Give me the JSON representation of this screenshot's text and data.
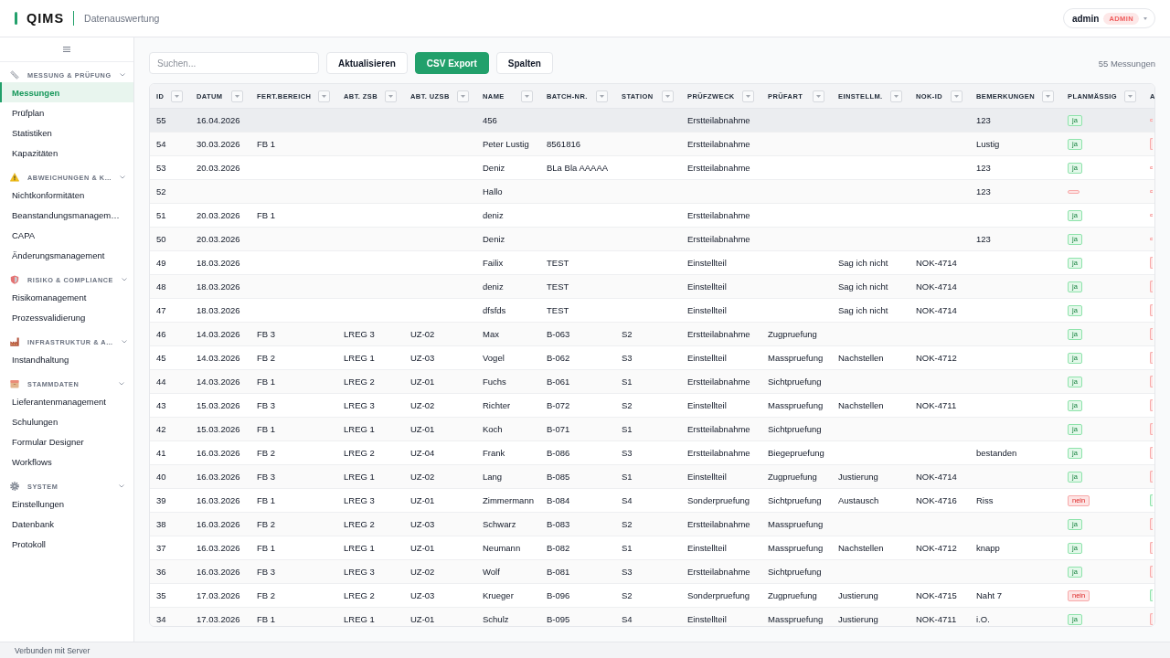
{
  "header": {
    "logo": "QIMS",
    "title": "Datenauswertung",
    "user": {
      "name": "admin",
      "role": "ADMIN"
    }
  },
  "sidebar": {
    "groups": [
      {
        "title": "MESSUNG & PRÜFUNG",
        "expanded": true,
        "items": [
          {
            "label": "Messungen",
            "selected": true
          },
          {
            "label": "Prüfplan",
            "selected": false
          },
          {
            "label": "Statistiken",
            "selected": false
          },
          {
            "label": "Kapazitäten",
            "selected": false
          }
        ]
      },
      {
        "title": "ABWEICHUNGEN & K…",
        "expanded": true,
        "items": [
          {
            "label": "Nichtkonformitäten",
            "selected": false
          },
          {
            "label": "Beanstandungsmanagem…",
            "selected": false
          },
          {
            "label": "CAPA",
            "selected": false
          },
          {
            "label": "Änderungsmanagement",
            "selected": false
          }
        ]
      },
      {
        "title": "RISIKO & COMPLIANCE",
        "expanded": true,
        "items": [
          {
            "label": "Risikomanagement",
            "selected": false
          },
          {
            "label": "Prozessvalidierung",
            "selected": false
          }
        ]
      },
      {
        "title": "INFRASTRUKTUR & A…",
        "expanded": true,
        "items": [
          {
            "label": "Instandhaltung",
            "selected": false
          }
        ]
      },
      {
        "title": "STAMMDATEN",
        "expanded": true,
        "items": [
          {
            "label": "Lieferantenmanagement",
            "selected": false
          },
          {
            "label": "Schulungen",
            "selected": false
          },
          {
            "label": "Formular Designer",
            "selected": false
          },
          {
            "label": "Workflows",
            "selected": false
          }
        ]
      },
      {
        "title": "SYSTEM",
        "expanded": true,
        "items": [
          {
            "label": "Einstellungen",
            "selected": false
          },
          {
            "label": "Datenbank",
            "selected": false
          },
          {
            "label": "Protokoll",
            "selected": false
          }
        ]
      }
    ]
  },
  "toolbar": {
    "search": {
      "placeholder": "Suchen..."
    },
    "buttons": [
      {
        "label": "Aktualisieren",
        "kind": "default"
      },
      {
        "label": "CSV Export",
        "kind": "primary"
      },
      {
        "label": "Spalten",
        "kind": "default"
      }
    ],
    "count": "55 Messungen"
  },
  "table": {
    "columns": [
      {
        "label": "ID"
      },
      {
        "label": "DATUM"
      },
      {
        "label": "FERT.BEREICH"
      },
      {
        "label": "ABT. ZSB"
      },
      {
        "label": "ABT. UZSB"
      },
      {
        "label": "NAME"
      },
      {
        "label": "BATCH-NR."
      },
      {
        "label": "STATION"
      },
      {
        "label": "PRÜFZWECK"
      },
      {
        "label": "PRÜFART"
      },
      {
        "label": "EINSTELLM."
      },
      {
        "label": "NOK-ID"
      },
      {
        "label": "BEMERKUNGEN"
      },
      {
        "label": "PLANMÄSSIG"
      },
      {
        "label": "A"
      }
    ],
    "rows": [
      {
        "selected": true,
        "id": "55",
        "datum": "16.04.2026",
        "name": "456",
        "pruefzweck": "Erstteilabnahme",
        "bemerkungen": "123",
        "planmaessig": {
          "text": "ja",
          "kind": "positive",
          "empty": false
        },
        "column_15": {
          "kind": "negative",
          "empty": true
        }
      },
      {
        "selected": false,
        "id": "54",
        "datum": "30.03.2026",
        "fert_bereich": "FB 1",
        "name": "Peter Lustig",
        "batch_nr": "8561816",
        "pruefzweck": "Erstteilabnahme",
        "bemerkungen": "Lustig",
        "planmaessig": {
          "text": "ja",
          "kind": "positive",
          "empty": false
        },
        "column_15": {
          "kind": "negative",
          "empty": false
        }
      },
      {
        "selected": false,
        "id": "53",
        "datum": "20.03.2026",
        "name": "Deniz",
        "batch_nr": "BLa Bla AAAAA",
        "pruefzweck": "Erstteilabnahme",
        "bemerkungen": "123",
        "planmaessig": {
          "text": "ja",
          "kind": "positive",
          "empty": false
        },
        "column_15": {
          "kind": "negative",
          "empty": true
        }
      },
      {
        "selected": false,
        "id": "52",
        "name": "Hallo",
        "bemerkungen": "123",
        "planmaessig": {
          "kind": "negative",
          "empty": true
        },
        "column_15": {
          "kind": "negative",
          "empty": true
        }
      },
      {
        "selected": false,
        "id": "51",
        "datum": "20.03.2026",
        "fert_bereich": "FB 1",
        "name": "deniz",
        "pruefzweck": "Erstteilabnahme",
        "planmaessig": {
          "text": "ja",
          "kind": "positive",
          "empty": false
        },
        "column_15": {
          "kind": "negative",
          "empty": true
        }
      },
      {
        "selected": false,
        "id": "50",
        "datum": "20.03.2026",
        "name": "Deniz",
        "pruefzweck": "Erstteilabnahme",
        "bemerkungen": "123",
        "planmaessig": {
          "text": "ja",
          "kind": "positive",
          "empty": false
        },
        "column_15": {
          "kind": "negative",
          "empty": true
        }
      },
      {
        "selected": false,
        "id": "49",
        "datum": "18.03.2026",
        "name": "Failix",
        "batch_nr": "TEST",
        "pruefzweck": "Einstellteil",
        "einstellm": "Sag ich nicht",
        "nok_id": "NOK-4714",
        "planmaessig": {
          "text": "ja",
          "kind": "positive",
          "empty": false
        },
        "column_15": {
          "kind": "negative",
          "empty": false
        }
      },
      {
        "selected": false,
        "id": "48",
        "datum": "18.03.2026",
        "name": "deniz",
        "batch_nr": "TEST",
        "pruefzweck": "Einstellteil",
        "einstellm": "Sag ich nicht",
        "nok_id": "NOK-4714",
        "planmaessig": {
          "text": "ja",
          "kind": "positive",
          "empty": false
        },
        "column_15": {
          "kind": "negative",
          "empty": false
        }
      },
      {
        "selected": false,
        "id": "47",
        "datum": "18.03.2026",
        "name": "dfsfds",
        "batch_nr": "TEST",
        "pruefzweck": "Einstellteil",
        "einstellm": "Sag ich nicht",
        "nok_id": "NOK-4714",
        "planmaessig": {
          "text": "ja",
          "kind": "positive",
          "empty": false
        },
        "column_15": {
          "kind": "negative",
          "empty": false
        }
      },
      {
        "selected": false,
        "id": "46",
        "datum": "14.03.2026",
        "fert_bereich": "FB 3",
        "abt_zsb": "LREG 3",
        "abt_uzsb": "UZ-02",
        "name": "Max",
        "batch_nr": "B-063",
        "station": "S2",
        "pruefzweck": "Erstteilabnahme",
        "pruefart": "Zugpruefung",
        "planmaessig": {
          "text": "ja",
          "kind": "positive",
          "empty": false
        },
        "column_15": {
          "kind": "negative",
          "empty": false
        }
      },
      {
        "selected": false,
        "id": "45",
        "datum": "14.03.2026",
        "fert_bereich": "FB 2",
        "abt_zsb": "LREG 1",
        "abt_uzsb": "UZ-03",
        "name": "Vogel",
        "batch_nr": "B-062",
        "station": "S3",
        "pruefzweck": "Einstellteil",
        "pruefart": "Masspruefung",
        "einstellm": "Nachstellen",
        "nok_id": "NOK-4712",
        "planmaessig": {
          "text": "ja",
          "kind": "positive",
          "empty": false
        },
        "column_15": {
          "kind": "negative",
          "empty": false
        }
      },
      {
        "selected": false,
        "id": "44",
        "datum": "14.03.2026",
        "fert_bereich": "FB 1",
        "abt_zsb": "LREG 2",
        "abt_uzsb": "UZ-01",
        "name": "Fuchs",
        "batch_nr": "B-061",
        "station": "S1",
        "pruefzweck": "Erstteilabnahme",
        "pruefart": "Sichtpruefung",
        "planmaessig": {
          "text": "ja",
          "kind": "positive",
          "empty": false
        },
        "column_15": {
          "kind": "negative",
          "empty": false
        }
      },
      {
        "selected": false,
        "id": "43",
        "datum": "15.03.2026",
        "fert_bereich": "FB 3",
        "abt_zsb": "LREG 3",
        "abt_uzsb": "UZ-02",
        "name": "Richter",
        "batch_nr": "B-072",
        "station": "S2",
        "pruefzweck": "Einstellteil",
        "pruefart": "Masspruefung",
        "einstellm": "Nachstellen",
        "nok_id": "NOK-4711",
        "planmaessig": {
          "text": "ja",
          "kind": "positive",
          "empty": false
        },
        "column_15": {
          "kind": "negative",
          "empty": false
        }
      },
      {
        "selected": false,
        "id": "42",
        "datum": "15.03.2026",
        "fert_bereich": "FB 1",
        "abt_zsb": "LREG 1",
        "abt_uzsb": "UZ-01",
        "name": "Koch",
        "batch_nr": "B-071",
        "station": "S1",
        "pruefzweck": "Erstteilabnahme",
        "pruefart": "Sichtpruefung",
        "planmaessig": {
          "text": "ja",
          "kind": "positive",
          "empty": false
        },
        "column_15": {
          "kind": "negative",
          "empty": false
        }
      },
      {
        "selected": false,
        "id": "41",
        "datum": "16.03.2026",
        "fert_bereich": "FB 2",
        "abt_zsb": "LREG 2",
        "abt_uzsb": "UZ-04",
        "name": "Frank",
        "batch_nr": "B-086",
        "station": "S3",
        "pruefzweck": "Erstteilabnahme",
        "pruefart": "Biegepruefung",
        "bemerkungen": "bestanden",
        "planmaessig": {
          "text": "ja",
          "kind": "positive",
          "empty": false
        },
        "column_15": {
          "kind": "negative",
          "empty": false
        }
      },
      {
        "selected": false,
        "id": "40",
        "datum": "16.03.2026",
        "fert_bereich": "FB 3",
        "abt_zsb": "LREG 1",
        "abt_uzsb": "UZ-02",
        "name": "Lang",
        "batch_nr": "B-085",
        "station": "S1",
        "pruefzweck": "Einstellteil",
        "pruefart": "Zugpruefung",
        "einstellm": "Justierung",
        "nok_id": "NOK-4714",
        "planmaessig": {
          "text": "ja",
          "kind": "positive",
          "empty": false
        },
        "column_15": {
          "kind": "negative",
          "empty": false
        }
      },
      {
        "selected": false,
        "id": "39",
        "datum": "16.03.2026",
        "fert_bereich": "FB 1",
        "abt_zsb": "LREG 3",
        "abt_uzsb": "UZ-01",
        "name": "Zimmermann",
        "batch_nr": "B-084",
        "station": "S4",
        "pruefzweck": "Sonderpruefung",
        "pruefart": "Sichtpruefung",
        "einstellm": "Austausch",
        "nok_id": "NOK-4716",
        "bemerkungen": "Riss",
        "planmaessig": {
          "text": "nein",
          "kind": "negative",
          "empty": false
        },
        "column_15": {
          "kind": "positive",
          "empty": false
        }
      },
      {
        "selected": false,
        "id": "38",
        "datum": "16.03.2026",
        "fert_bereich": "FB 2",
        "abt_zsb": "LREG 2",
        "abt_uzsb": "UZ-03",
        "name": "Schwarz",
        "batch_nr": "B-083",
        "station": "S2",
        "pruefzweck": "Erstteilabnahme",
        "pruefart": "Masspruefung",
        "planmaessig": {
          "text": "ja",
          "kind": "positive",
          "empty": false
        },
        "column_15": {
          "kind": "negative",
          "empty": false
        }
      },
      {
        "selected": false,
        "id": "37",
        "datum": "16.03.2026",
        "fert_bereich": "FB 1",
        "abt_zsb": "LREG 1",
        "abt_uzsb": "UZ-01",
        "name": "Neumann",
        "batch_nr": "B-082",
        "station": "S1",
        "pruefzweck": "Einstellteil",
        "pruefart": "Masspruefung",
        "einstellm": "Nachstellen",
        "nok_id": "NOK-4712",
        "bemerkungen": "knapp",
        "planmaessig": {
          "text": "ja",
          "kind": "positive",
          "empty": false
        },
        "column_15": {
          "kind": "negative",
          "empty": false
        }
      },
      {
        "selected": false,
        "id": "36",
        "datum": "16.03.2026",
        "fert_bereich": "FB 3",
        "abt_zsb": "LREG 3",
        "abt_uzsb": "UZ-02",
        "name": "Wolf",
        "batch_nr": "B-081",
        "station": "S3",
        "pruefzweck": "Erstteilabnahme",
        "pruefart": "Sichtpruefung",
        "planmaessig": {
          "text": "ja",
          "kind": "positive",
          "empty": false
        },
        "column_15": {
          "kind": "negative",
          "empty": false
        }
      },
      {
        "selected": false,
        "id": "35",
        "datum": "17.03.2026",
        "fert_bereich": "FB 2",
        "abt_zsb": "LREG 2",
        "abt_uzsb": "UZ-03",
        "name": "Krueger",
        "batch_nr": "B-096",
        "station": "S2",
        "pruefzweck": "Sonderpruefung",
        "pruefart": "Zugpruefung",
        "einstellm": "Justierung",
        "nok_id": "NOK-4715",
        "bemerkungen": "Naht 7",
        "planmaessig": {
          "text": "nein",
          "kind": "negative",
          "empty": false
        },
        "column_15": {
          "kind": "positive",
          "empty": false
        }
      },
      {
        "selected": false,
        "id": "34",
        "datum": "17.03.2026",
        "fert_bereich": "FB 1",
        "abt_zsb": "LREG 1",
        "abt_uzsb": "UZ-01",
        "name": "Schulz",
        "batch_nr": "B-095",
        "station": "S4",
        "pruefzweck": "Einstellteil",
        "pruefart": "Masspruefung",
        "einstellm": "Justierung",
        "nok_id": "NOK-4711",
        "bemerkungen": "i.O.",
        "planmaessig": {
          "text": "ja",
          "kind": "positive",
          "empty": false
        },
        "column_15": {
          "kind": "negative",
          "empty": false
        }
      }
    ]
  },
  "status_bar": {
    "text": "Verbunden mit Server"
  }
}
